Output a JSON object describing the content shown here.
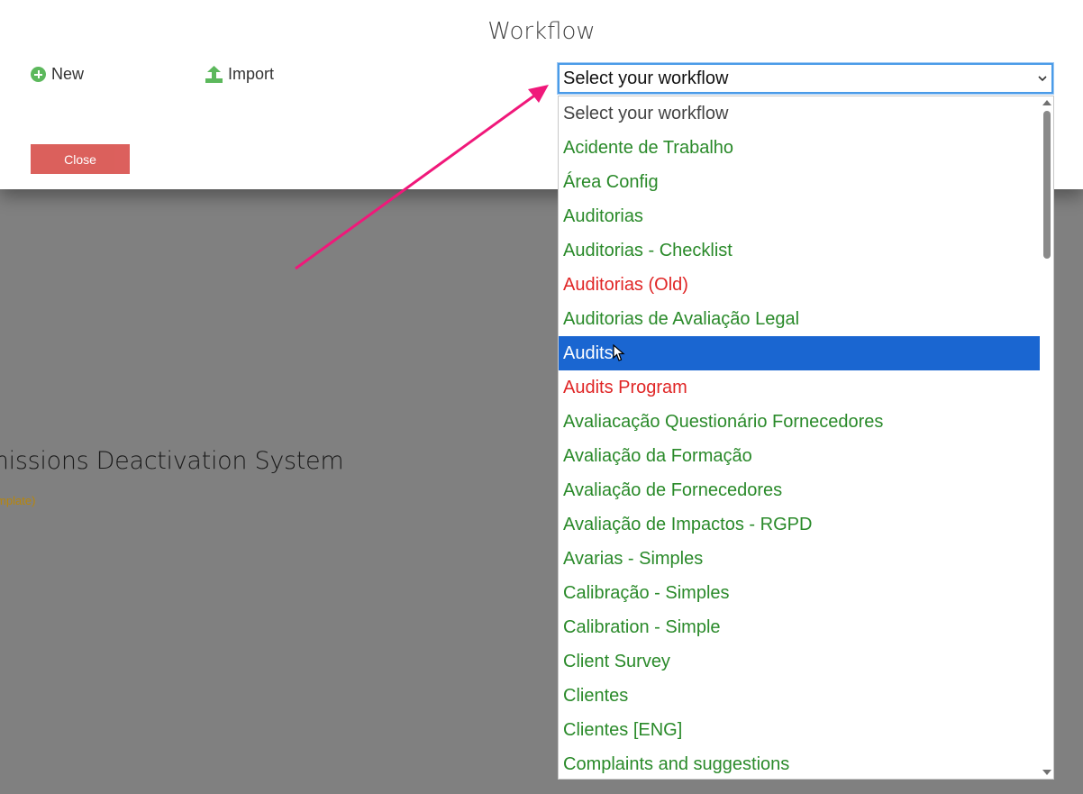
{
  "background": {
    "title": "Permissions Deactivation System",
    "subtitle": "(Template)"
  },
  "modal": {
    "title": "Workflow",
    "new_label": "New",
    "import_label": "Import",
    "close_label": "Close"
  },
  "workflow_select": {
    "selected_value": "Select your workflow",
    "options": [
      {
        "label": "Select your workflow",
        "status": "placeholder"
      },
      {
        "label": "Acidente de Trabalho",
        "status": "active"
      },
      {
        "label": "Área Config",
        "status": "active"
      },
      {
        "label": "Auditorias",
        "status": "active"
      },
      {
        "label": "Auditorias - Checklist",
        "status": "active"
      },
      {
        "label": "Auditorias (Old)",
        "status": "inactive"
      },
      {
        "label": "Auditorias de Avaliação Legal",
        "status": "active"
      },
      {
        "label": "Audits",
        "status": "highlighted"
      },
      {
        "label": "Audits Program",
        "status": "inactive"
      },
      {
        "label": "Avaliacação Questionário Fornecedores",
        "status": "active"
      },
      {
        "label": "Avaliação da Formação",
        "status": "active"
      },
      {
        "label": "Avaliação de Fornecedores",
        "status": "active"
      },
      {
        "label": "Avaliação de Impactos - RGPD",
        "status": "active"
      },
      {
        "label": "Avarias - Simples",
        "status": "active"
      },
      {
        "label": "Calibração - Simples",
        "status": "active"
      },
      {
        "label": "Calibration - Simple",
        "status": "active"
      },
      {
        "label": "Client Survey",
        "status": "active"
      },
      {
        "label": "Clientes",
        "status": "active"
      },
      {
        "label": "Clientes [ENG]",
        "status": "active"
      },
      {
        "label": "Complaints and suggestions",
        "status": "active"
      }
    ]
  },
  "colors": {
    "active_option": "#2a8a2a",
    "inactive_option": "#e02626",
    "highlight": "#1a66d1",
    "close_button": "#d9534f",
    "annotation_arrow": "#f0187a"
  },
  "icons": {
    "new": "plus-circle-icon",
    "import": "upload-icon"
  }
}
